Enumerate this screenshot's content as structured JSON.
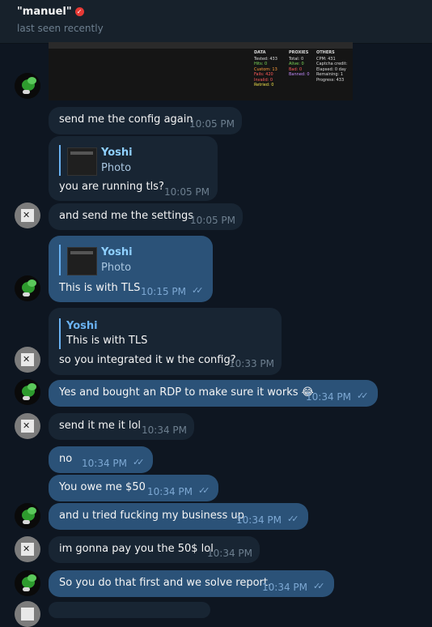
{
  "header": {
    "name": "\"manuel\"",
    "status": "last seen recently"
  },
  "screenshot": {
    "data": {
      "title": "DATA",
      "rows": [
        {
          "label": "Tested:",
          "value": "433",
          "color": "#dddddd"
        },
        {
          "label": "Hits:",
          "value": "0",
          "color": "#7fdc5a"
        },
        {
          "label": "Custom:",
          "value": "13",
          "color": "#ff9d3a"
        },
        {
          "label": "Fails:",
          "value": "420",
          "color": "#ff5a5a"
        },
        {
          "label": "Invalid:",
          "value": "0",
          "color": "#ff5a5a"
        },
        {
          "label": "Retried:",
          "value": "0",
          "color": "#f1e34b"
        }
      ]
    },
    "proxies": {
      "title": "PROXIES",
      "rows": [
        {
          "label": "Total:",
          "value": "0",
          "color": "#dddddd"
        },
        {
          "label": "Alive:",
          "value": "0",
          "color": "#7fdc5a"
        },
        {
          "label": "Bad:",
          "value": "0",
          "color": "#ff5a5a"
        },
        {
          "label": "Banned:",
          "value": "0",
          "color": "#c58cff"
        }
      ]
    },
    "others": {
      "title": "OTHERS",
      "rows": [
        {
          "label": "CPM:",
          "value": "431",
          "color": "#dddddd"
        },
        {
          "label": "Captcha credit:",
          "value": "",
          "color": "#dddddd"
        },
        {
          "label": "Elapsed:",
          "value": "0 day",
          "color": "#dddddd"
        },
        {
          "label": "Remaining:",
          "value": "1",
          "color": "#dddddd"
        },
        {
          "label": "Progress:",
          "value": "433",
          "color": "#dddddd"
        }
      ]
    }
  },
  "messages": [
    {
      "text": "send me the config again",
      "time": "10:05 PM"
    },
    {
      "reply_name": "Yoshi",
      "reply_sub": "Photo",
      "text": "you are running tls?",
      "time": "10:05 PM"
    },
    {
      "text": "and send me the settings",
      "time": "10:05 PM"
    },
    {
      "reply_name": "Yoshi",
      "reply_sub": "Photo",
      "text": "This is with TLS",
      "time": "10:15 PM"
    },
    {
      "reply_name": "Yoshi",
      "reply_sub": "This is with TLS",
      "text": "so you integrated it w the config?",
      "time": "10:33 PM"
    },
    {
      "text": "Yes and bought an RDP to make sure it works 😂",
      "time": "10:34 PM"
    },
    {
      "text": "send it me it lol",
      "time": "10:34 PM"
    },
    {
      "text": "no",
      "time": "10:34 PM"
    },
    {
      "text": "You owe me $50",
      "time": "10:34 PM"
    },
    {
      "text": "and u tried fucking my business up",
      "time": "10:34 PM"
    },
    {
      "text": "im gonna pay you the 50$ lol",
      "time": "10:34 PM"
    },
    {
      "text": "So you do that first and we solve report.",
      "time": "10:34 PM"
    }
  ],
  "colors": {
    "background": "#0e1621",
    "incoming": "#182533",
    "outgoing": "#2b5278",
    "accent": "#6ab2f2",
    "verified": "#e53935"
  },
  "icons": {
    "verified": "verified-badge-icon",
    "read": "double-check-icon"
  }
}
